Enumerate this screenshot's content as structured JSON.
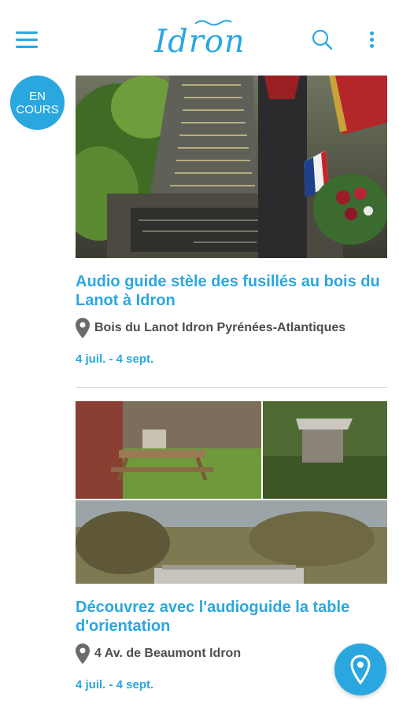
{
  "header": {
    "logo_text": "Idron",
    "menu_icon": "hamburger-menu-icon",
    "search_icon": "search-icon",
    "more_icon": "more-vertical-icon"
  },
  "badge": {
    "line1": "EN",
    "line2": "COURS"
  },
  "colors": {
    "accent": "#2aa7df",
    "text": "#4d4d4d",
    "divider": "#d9d9d9"
  },
  "events": [
    {
      "title": "Audio guide stèle des fusillés au bois du Lanot à Idron",
      "location": "Bois du Lanot Idron Pyrénées-Atlantiques",
      "dates": "4 juil. - 4 sept.",
      "image": "memorial-stele-photo"
    },
    {
      "title": "Découvrez avec l'audioguide la table d'orientation",
      "location": "4 Av. de Beaumont Idron",
      "dates": "4 juil. - 4 sept.",
      "image": "orientation-table-collage"
    }
  ],
  "fab": {
    "icon": "map-pin-icon"
  }
}
